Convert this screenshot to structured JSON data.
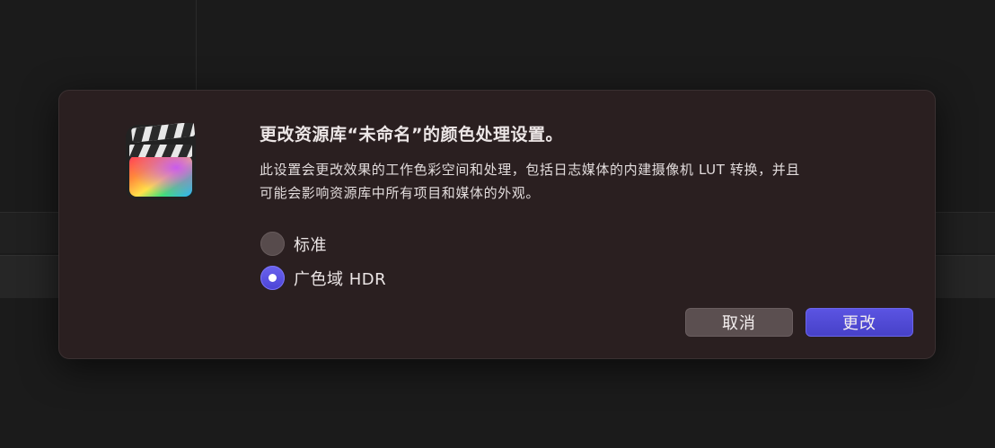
{
  "dialog": {
    "title": "更改资源库“未命名”的颜色处理设置。",
    "description_line1": "此设置会更改效果的工作色彩空间和处理，包括日志媒体的内建摄像机 LUT 转换，并且",
    "description_line2": "可能会影响资源库中所有项目和媒体的外观。",
    "options": [
      {
        "label": "标准",
        "selected": false
      },
      {
        "label": "广色域 HDR",
        "selected": true
      }
    ],
    "cancel_label": "取消",
    "confirm_label": "更改",
    "app_icon": "final-cut-pro-clapperboard-icon"
  },
  "colors": {
    "dialog_bg": "#2a1f20",
    "accent": "#5148d8",
    "radio_off": "#574b4c",
    "cancel_bg": "#5b4f50"
  }
}
